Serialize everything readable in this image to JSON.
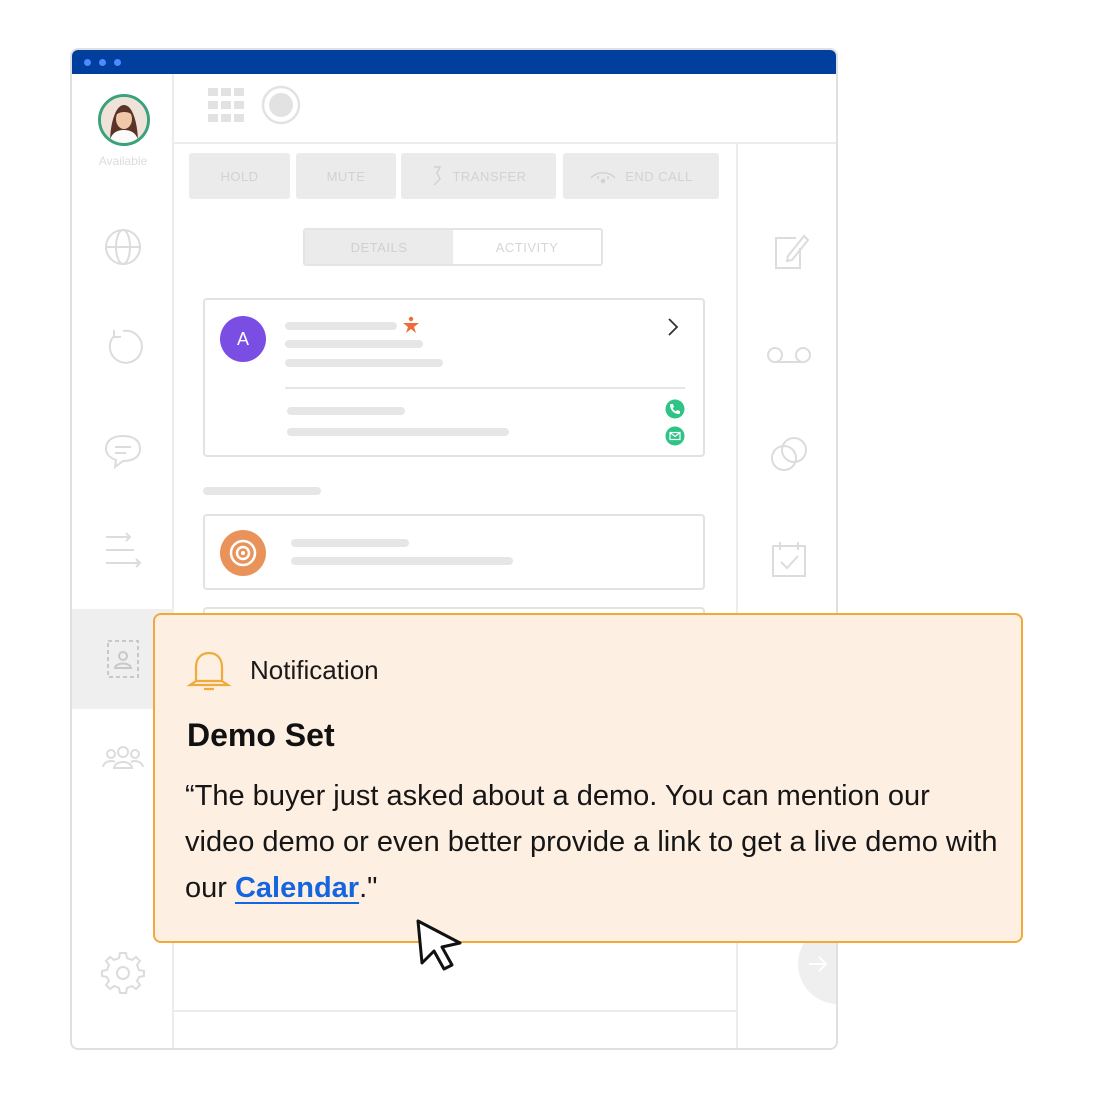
{
  "user": {
    "status": "Available"
  },
  "call_controls": {
    "hold": "HOLD",
    "mute": "MUTE",
    "transfer": "TRANSFER",
    "end_call": "END CALL"
  },
  "tabs": {
    "details": "DETAILS",
    "activity": "ACTIVITY"
  },
  "contact": {
    "initial": "A"
  },
  "colors": {
    "titlebar": "#003f9e",
    "contact_avatar": "#7b4ee3",
    "accent_star": "#ef6b3a",
    "phone_badge": "#2ec486",
    "target_badge": "#e9935a",
    "notification_border": "#f1a93a",
    "link": "#1565e0"
  },
  "notification": {
    "header": "Notification",
    "title": "Demo Set",
    "body_before_link": "“The buyer just asked about a demo. You can mention our video demo or even better provide a link to get a live demo with our ",
    "link_text": "Calendar",
    "body_after_link": ".\""
  }
}
